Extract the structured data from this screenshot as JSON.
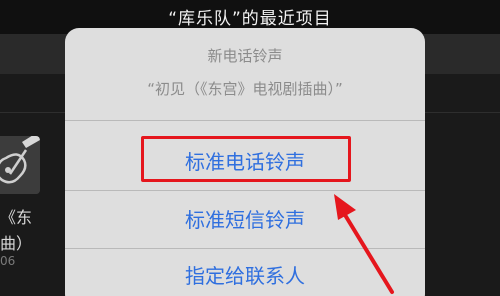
{
  "header": {
    "title": "“库乐队”的最近项目"
  },
  "background_item": {
    "line1": "《东",
    "line2": "曲）",
    "line3": "06",
    "thumbnail_icon": "guitar-icon"
  },
  "action_sheet": {
    "title": "新电话铃声",
    "subtitle": "“初见（《东宫》电视剧插曲）”",
    "options": [
      {
        "label": "标准电话铃声"
      },
      {
        "label": "标准短信铃声"
      },
      {
        "label": "指定给联系人"
      }
    ]
  },
  "annotation": {
    "highlight_color": "#e5161d",
    "highlighted_option": "标准电话铃声",
    "arrow_icon": "red-arrow-icon"
  },
  "colors": {
    "sheet_background": "#dedede",
    "option_text": "#2f6fdf",
    "secondary_text": "#8c8c8c"
  }
}
